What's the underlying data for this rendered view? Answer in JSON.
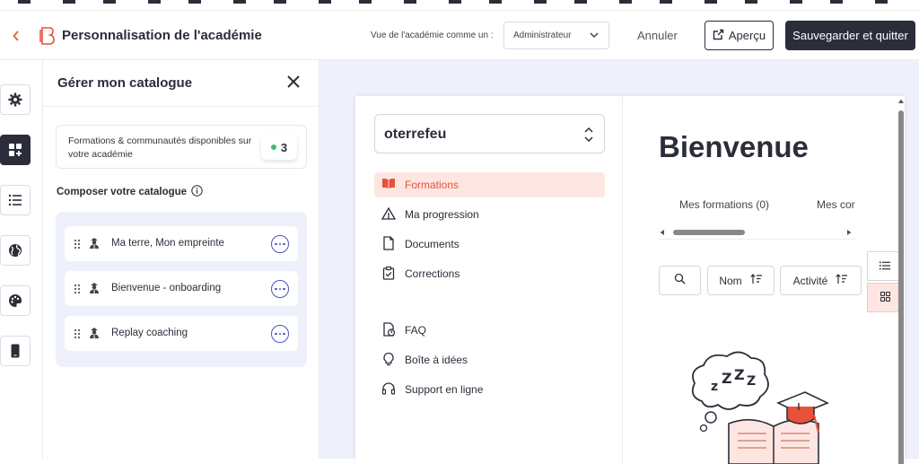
{
  "header": {
    "title": "Personnalisation de l'académie",
    "view_as_label": "Vue de l'académie comme un :",
    "view_as_value": "Administrateur",
    "cancel_label": "Annuler",
    "preview_label": "Aperçu",
    "save_label": "Sauvegarder et quitter"
  },
  "rail": {
    "items": [
      "gear-icon",
      "add-widget-icon",
      "list-icon",
      "globe-icon",
      "palette-icon",
      "mobile-icon"
    ],
    "active": "add-widget-icon"
  },
  "panel": {
    "title": "Gérer mon catalogue",
    "available_text": "Formations & communautés disponibles sur votre académie",
    "available_count": "3",
    "compose_label": "Composer votre catalogue",
    "items": [
      {
        "label": "Ma terre, Mon empreinte"
      },
      {
        "label": "Bienvenue - onboarding"
      },
      {
        "label": "Replay coaching"
      }
    ]
  },
  "preview": {
    "academy_name": "oterrefeu",
    "nav": [
      {
        "label": "Formations",
        "icon": "book-icon",
        "active": true
      },
      {
        "label": "Ma progression",
        "icon": "progress-icon"
      },
      {
        "label": "Documents",
        "icon": "document-icon"
      },
      {
        "label": "Corrections",
        "icon": "clipboard-check-icon"
      },
      {
        "label": "FAQ",
        "icon": "faq-icon"
      },
      {
        "label": "Boîte à idées",
        "icon": "lightbulb-icon"
      },
      {
        "label": "Support en ligne",
        "icon": "headset-icon"
      }
    ],
    "welcome": "Bienvenue",
    "tabs": [
      "Mes formations (0)",
      "Mes cor"
    ],
    "sort_name": "Nom",
    "sort_activity": "Activité"
  },
  "colors": {
    "accent": "#e8513a",
    "dark": "#2b2d3a",
    "canvas_bg": "#eef0fb"
  }
}
